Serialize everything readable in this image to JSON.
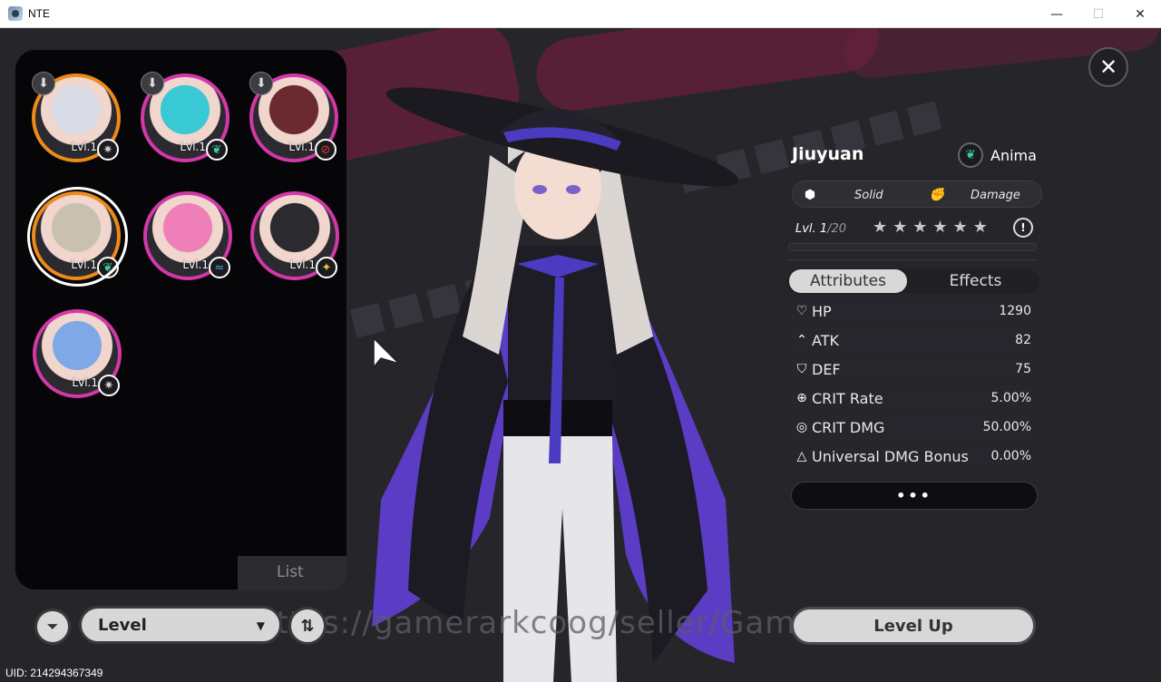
{
  "window": {
    "title": "NTE",
    "min": "—",
    "max": "☐",
    "close": "✕"
  },
  "roster": {
    "list_label": "List",
    "characters": [
      {
        "level": "Lvl.1",
        "element_icon": "gear-icon",
        "element_glyph": "✷",
        "element_color": "#cfd6cf",
        "downloadable": true,
        "rarity_color": "#ee8a1a",
        "hair": "#d9dbe6"
      },
      {
        "level": "Lvl.1",
        "element_icon": "anima-icon",
        "element_glyph": "❦",
        "element_color": "#3ccf9a",
        "downloadable": true,
        "rarity_color": "#d238a8",
        "hair": "#38c9d4"
      },
      {
        "level": "Lvl.1",
        "element_icon": "cancel-icon",
        "element_glyph": "⊘",
        "element_color": "#e03232",
        "downloadable": true,
        "rarity_color": "#d238a8",
        "hair": "#6b2a30"
      },
      {
        "level": "Lvl.1",
        "element_icon": "anima-icon",
        "element_glyph": "❦",
        "element_color": "#3ccf9a",
        "downloadable": false,
        "rarity_color": "#ee8a1a",
        "hair": "#c8c0b0"
      },
      {
        "level": "Lvl.1",
        "element_icon": "wave-icon",
        "element_glyph": "≈",
        "element_color": "#3aa8e8",
        "downloadable": false,
        "rarity_color": "#d238a8",
        "hair": "#ef7fb8"
      },
      {
        "level": "Lvl.1",
        "element_icon": "star-icon",
        "element_glyph": "✦",
        "element_color": "#e8c431",
        "downloadable": false,
        "rarity_color": "#d238a8",
        "hair": "#2b2a2e"
      },
      {
        "level": "Lvl.1",
        "element_icon": "gear-icon",
        "element_glyph": "✷",
        "element_color": "#cfd6cf",
        "downloadable": false,
        "rarity_color": "#d238a8",
        "hair": "#7ea8e6"
      }
    ]
  },
  "controls": {
    "sort_label": "Level",
    "filter_icon": "⏷",
    "sort_icon": "⇅"
  },
  "watermark": "https://gamerarkcoog/seller/GameNe",
  "uid": "UID: 214294367349",
  "character": {
    "name": "Jiuyuan",
    "element": "Anima",
    "tags": [
      "Solid",
      "Damage"
    ],
    "level_current": "Lvl. 1",
    "level_max": "/20",
    "stars": "★★★★★★"
  },
  "tabs": {
    "attributes": "Attributes",
    "effects": "Effects"
  },
  "stats": [
    {
      "icon": "♡",
      "name": "HP",
      "value": "1290"
    },
    {
      "icon": "⌃",
      "name": "ATK",
      "value": "82"
    },
    {
      "icon": "⛉",
      "name": "DEF",
      "value": "75"
    },
    {
      "icon": "⊕",
      "name": "CRIT Rate",
      "value": "5.00%"
    },
    {
      "icon": "◎",
      "name": "CRIT DMG",
      "value": "50.00%"
    },
    {
      "icon": "△",
      "name": "Universal DMG Bonus",
      "value": "0.00%"
    }
  ],
  "more": "•••",
  "level_up": "Level Up"
}
